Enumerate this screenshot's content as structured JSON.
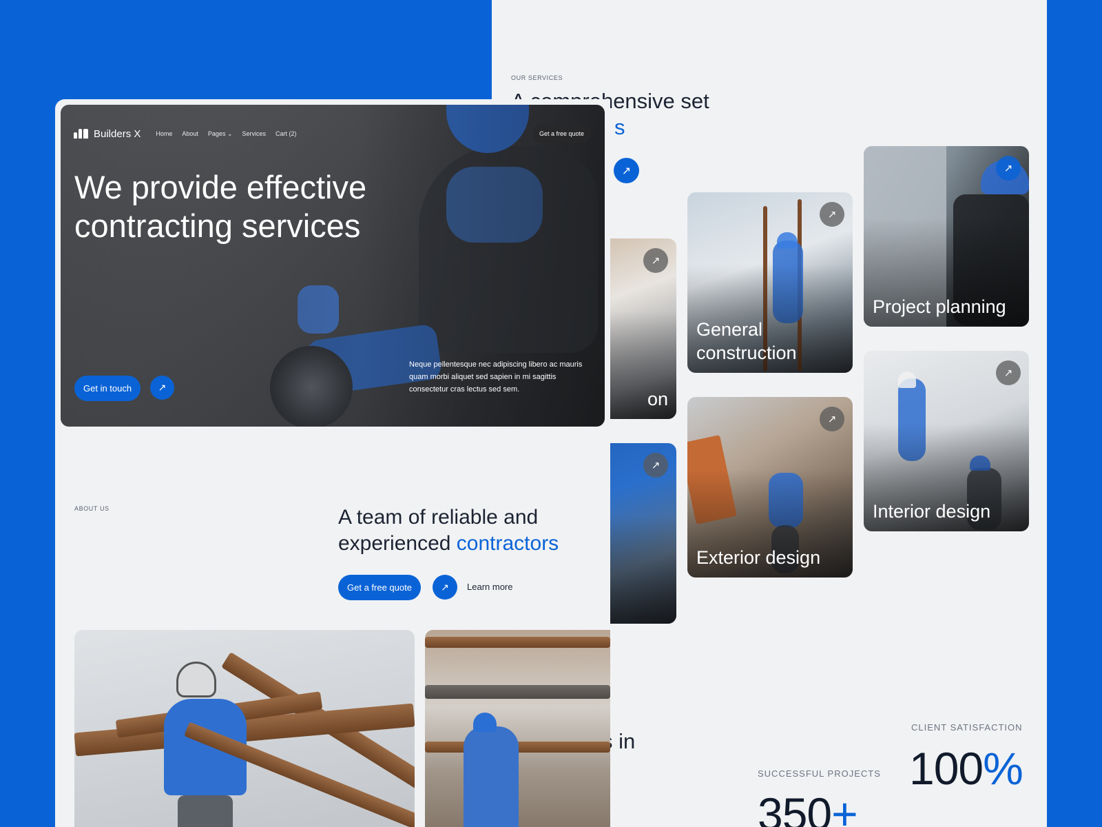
{
  "services_page": {
    "eyebrow": "OUR SERVICES",
    "title_visible": "A comprehensive set",
    "title_accent_fragment": "s",
    "cards": [
      {
        "title": "General construction",
        "icon": "arrow-up-right-icon"
      },
      {
        "title": "Project planning",
        "icon": "arrow-up-right-icon"
      },
      {
        "title": "Exterior design",
        "icon": "arrow-up-right-icon"
      },
      {
        "title": "Interior design",
        "icon": "arrow-up-right-icon"
      }
    ],
    "partial_card_fragment": "on",
    "partial_text": "s in",
    "stats": [
      {
        "label": "SUCCESSFUL PROJECTS",
        "value": "350",
        "suffix": "+"
      },
      {
        "label": "CLIENT SATISFACTION",
        "value": "100",
        "suffix": "%"
      }
    ]
  },
  "home_page": {
    "brand": "Builders X",
    "nav": [
      "Home",
      "About",
      "Pages ⌄",
      "Services",
      "Cart (2)"
    ],
    "nav_cta": "Get a free quote",
    "hero": {
      "title": "We provide effective contracting services",
      "cta": "Get in touch",
      "arrow_icon": "arrow-up-right-icon",
      "description": "Neque pellentesque nec adipiscing libero ac mauris quam morbi aliquet sed sapien in mi sagittis consectetur cras lectus sed sem."
    },
    "about": {
      "eyebrow": "ABOUT US",
      "title_main": "A team of reliable and experienced ",
      "title_accent": "contractors",
      "cta": "Get a free quote",
      "learn_more": "Learn more"
    }
  },
  "colors": {
    "accent": "#0a63d6",
    "page_bg": "#f1f2f4",
    "text": "#1c2433"
  }
}
